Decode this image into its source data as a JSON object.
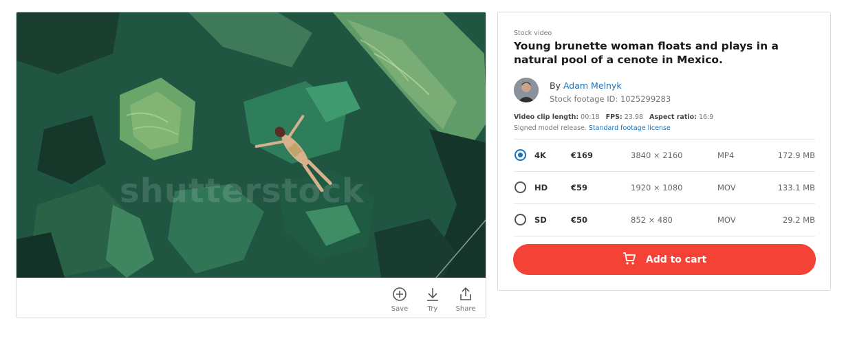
{
  "media": {
    "watermark": "shutterstock",
    "actions": [
      {
        "label": "Save",
        "icon": "plus-circle-icon"
      },
      {
        "label": "Try",
        "icon": "download-icon"
      },
      {
        "label": "Share",
        "icon": "share-icon"
      }
    ]
  },
  "details": {
    "kicker": "Stock video",
    "title": "Young brunette woman floats and plays in a natural pool of a cenote in Mexico.",
    "by_label": "By",
    "author": "Adam Melnyk",
    "footage_id": "Stock footage ID: 1025299283",
    "clip_length_label": "Video clip length:",
    "clip_length": "00:18",
    "fps_label": "FPS:",
    "fps": "23.98",
    "aspect_label": "Aspect ratio:",
    "aspect": "16:9",
    "release_text": "Signed model release.",
    "license_link": "Standard footage license"
  },
  "options": [
    {
      "size": "4K",
      "price": "€169",
      "resolution": "3840 × 2160",
      "format": "MP4",
      "filesize": "172.9 MB",
      "selected": true
    },
    {
      "size": "HD",
      "price": "€59",
      "resolution": "1920 × 1080",
      "format": "MOV",
      "filesize": "133.1 MB",
      "selected": false
    },
    {
      "size": "SD",
      "price": "€50",
      "resolution": "852 × 480",
      "format": "MOV",
      "filesize": "29.2 MB",
      "selected": false
    }
  ],
  "cart": {
    "label": "Add to cart",
    "icon": "cart-icon"
  },
  "colors": {
    "accent": "#1a70b8",
    "cart": "#f44336"
  }
}
